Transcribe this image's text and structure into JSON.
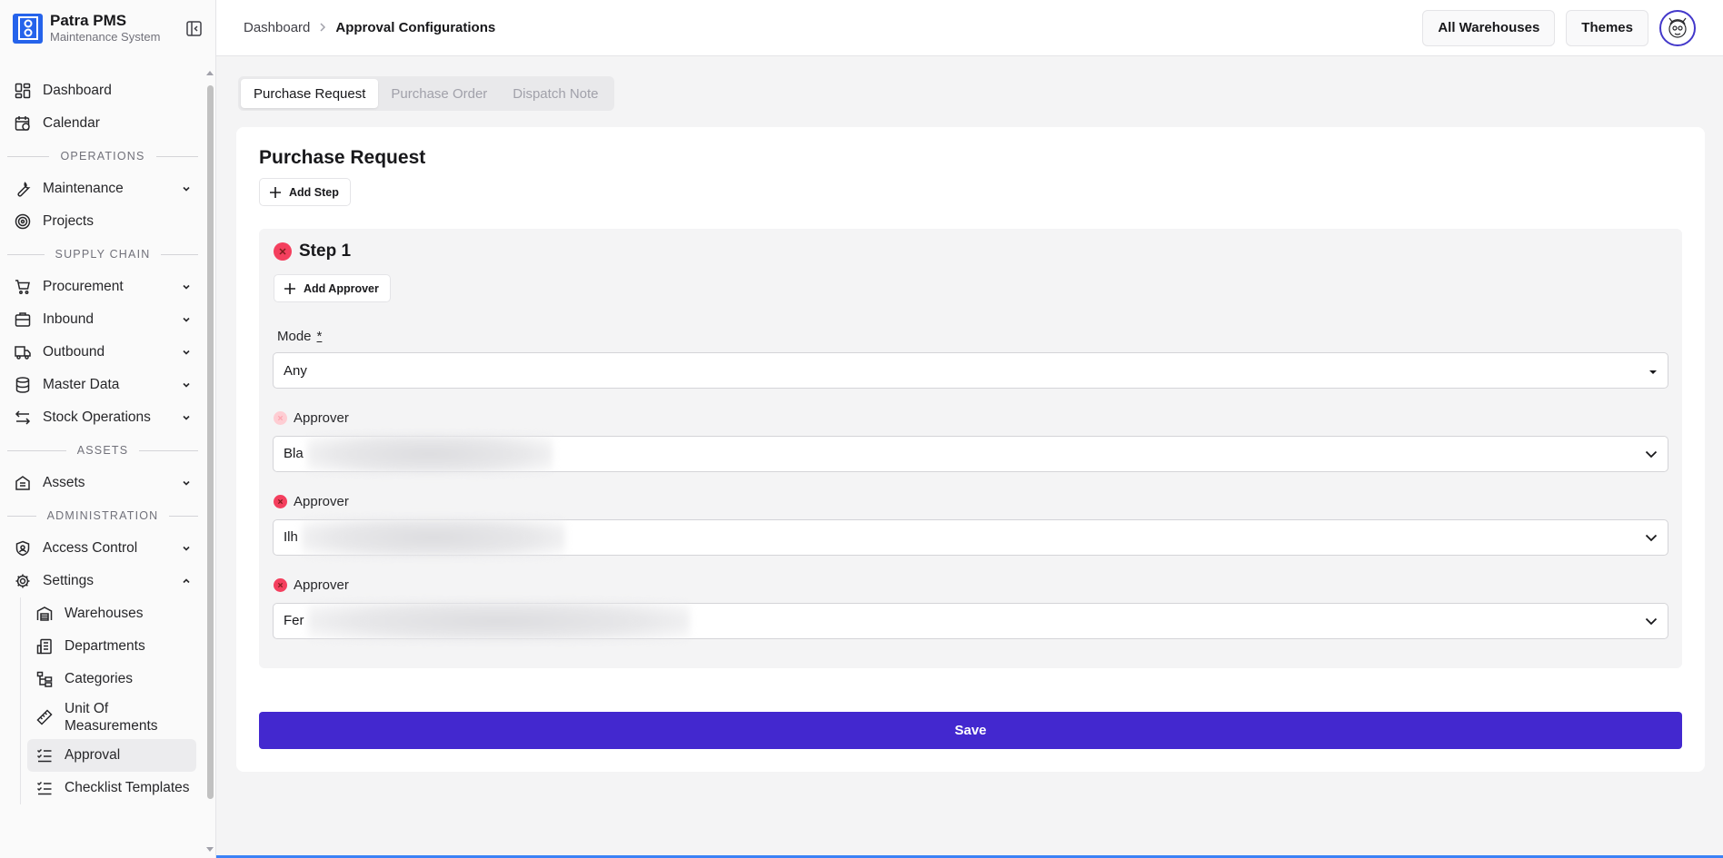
{
  "brand": {
    "title": "Patra PMS",
    "subtitle": "Maintenance System"
  },
  "sidebar": {
    "top_items": [
      {
        "label": "Dashboard",
        "icon": "dashboard-icon"
      },
      {
        "label": "Calendar",
        "icon": "calendar-icon"
      }
    ],
    "sections": {
      "operations": "OPERATIONS",
      "supply_chain": "SUPPLY CHAIN",
      "assets": "ASSETS",
      "administration": "ADMINISTRATION"
    },
    "operations_items": [
      {
        "label": "Maintenance",
        "icon": "wrench-icon"
      },
      {
        "label": "Projects",
        "icon": "target-icon"
      }
    ],
    "supply_items": [
      {
        "label": "Procurement",
        "icon": "cart-icon"
      },
      {
        "label": "Inbound",
        "icon": "package-icon"
      },
      {
        "label": "Outbound",
        "icon": "truck-icon"
      },
      {
        "label": "Master Data",
        "icon": "database-icon"
      },
      {
        "label": "Stock Operations",
        "icon": "transfer-icon"
      }
    ],
    "assets_items": [
      {
        "label": "Assets",
        "icon": "building-icon"
      }
    ],
    "admin_items": [
      {
        "label": "Access Control",
        "icon": "shield-icon"
      },
      {
        "label": "Settings",
        "icon": "gear-icon"
      }
    ],
    "settings_sub": [
      {
        "label": "Warehouses",
        "icon": "warehouse-icon"
      },
      {
        "label": "Departments",
        "icon": "departments-icon"
      },
      {
        "label": "Categories",
        "icon": "tree-icon"
      },
      {
        "label": "Unit Of Measurements",
        "icon": "ruler-icon"
      },
      {
        "label": "Approval",
        "icon": "list-checks-icon"
      },
      {
        "label": "Checklist Templates",
        "icon": "list-checks-icon"
      }
    ]
  },
  "header": {
    "breadcrumb_root": "Dashboard",
    "breadcrumb_current": "Approval Configurations",
    "warehouse_button": "All Warehouses",
    "themes_button": "Themes"
  },
  "tabs": [
    "Purchase Request",
    "Purchase Order",
    "Dispatch Note"
  ],
  "active_tab": "Purchase Request",
  "card": {
    "title": "Purchase Request",
    "add_step_label": "Add Step",
    "step": {
      "title": "Step 1",
      "add_approver_label": "Add Approver",
      "mode_label": "Mode",
      "mode_required_mark": "*",
      "mode_value": "Any",
      "approver_label": "Approver",
      "approvers": [
        {
          "value": "Bla"
        },
        {
          "value": "Ilh"
        },
        {
          "value": "Fer"
        }
      ]
    },
    "save_label": "Save"
  },
  "colors": {
    "primary": "#4328cf",
    "danger": "#f43f5e",
    "brand_logo": "#2563eb"
  }
}
